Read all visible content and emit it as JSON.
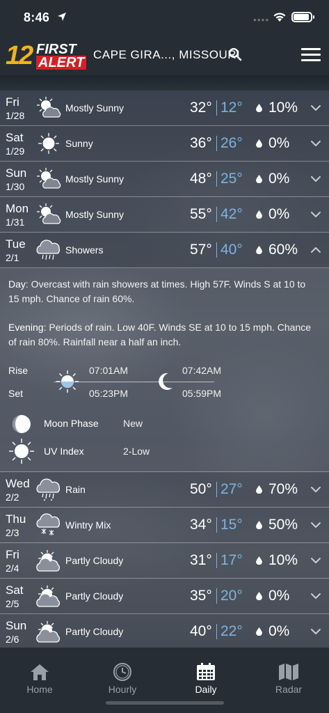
{
  "status": {
    "time": "8:46"
  },
  "header": {
    "logo_number": "12",
    "logo_first": "FIRST",
    "logo_alert": "ALERT",
    "location": "CAPE GIRA..., MISSOURI"
  },
  "days": [
    {
      "day": "Fri",
      "date": "1/28",
      "icon": "mostly-sunny-icon",
      "condition": "Mostly Sunny",
      "high": "32°",
      "low": "12°",
      "precip": "10%"
    },
    {
      "day": "Sat",
      "date": "1/29",
      "icon": "sunny-icon",
      "condition": "Sunny",
      "high": "36°",
      "low": "26°",
      "precip": "0%"
    },
    {
      "day": "Sun",
      "date": "1/30",
      "icon": "mostly-sunny-icon",
      "condition": "Mostly Sunny",
      "high": "48°",
      "low": "25°",
      "precip": "0%"
    },
    {
      "day": "Mon",
      "date": "1/31",
      "icon": "mostly-sunny-icon",
      "condition": "Mostly Sunny",
      "high": "55°",
      "low": "42°",
      "precip": "0%"
    },
    {
      "day": "Tue",
      "date": "2/1",
      "icon": "showers-icon",
      "condition": "Showers",
      "high": "57°",
      "low": "40°",
      "precip": "60%"
    },
    {
      "day": "Wed",
      "date": "2/2",
      "icon": "rain-icon",
      "condition": "Rain",
      "high": "50°",
      "low": "27°",
      "precip": "70%"
    },
    {
      "day": "Thu",
      "date": "2/3",
      "icon": "wintry-mix-icon",
      "condition": "Wintry Mix",
      "high": "34°",
      "low": "15°",
      "precip": "50%"
    },
    {
      "day": "Fri",
      "date": "2/4",
      "icon": "partly-cloudy-icon",
      "condition": "Partly Cloudy",
      "high": "31°",
      "low": "17°",
      "precip": "10%"
    },
    {
      "day": "Sat",
      "date": "2/5",
      "icon": "partly-cloudy-icon",
      "condition": "Partly Cloudy",
      "high": "35°",
      "low": "20°",
      "precip": "0%"
    },
    {
      "day": "Sun",
      "date": "2/6",
      "icon": "partly-cloudy-icon",
      "condition": "Partly Cloudy",
      "high": "40°",
      "low": "22°",
      "precip": "0%"
    }
  ],
  "details": {
    "day_label": "Day",
    "day_text": ": Overcast with rain showers at times. High 57F. Winds S at 10 to 15 mph. Chance of rain 60%.",
    "evening_label": "Evening",
    "evening_text": ": Periods of rain. Low 40F. Winds SE at 10 to 15 mph. Chance of rain 80%. Rainfall near a half an inch.",
    "rise_label": "Rise",
    "set_label": "Set",
    "sunrise": "07:01AM",
    "sunset": "05:23PM",
    "moonrise": "07:42AM",
    "moonset": "05:59PM",
    "moon_phase_label": "Moon Phase",
    "moon_phase": "New",
    "uv_label": "UV Index",
    "uv_value": "2-Low"
  },
  "tabs": [
    {
      "label": "Home",
      "icon": "home-icon"
    },
    {
      "label": "Hourly",
      "icon": "clock-icon"
    },
    {
      "label": "Daily",
      "icon": "calendar-icon"
    },
    {
      "label": "Radar",
      "icon": "map-icon"
    }
  ],
  "colors": {
    "low_temp": "#7fb2e0",
    "logo_yellow": "#f2b31b",
    "logo_red": "#d61f26",
    "bar_bg": "#262d35"
  }
}
